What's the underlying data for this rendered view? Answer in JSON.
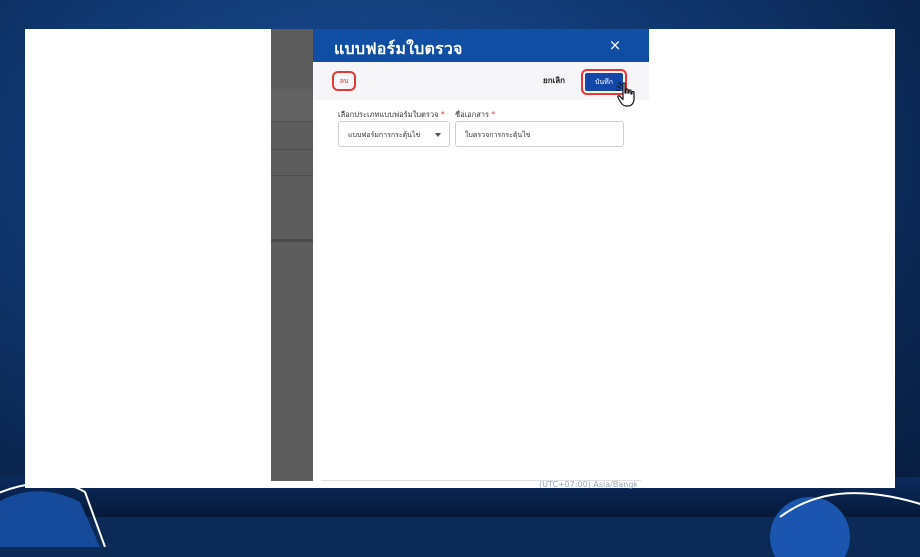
{
  "modal": {
    "title": "แบบฟอร์มใบตรวจ",
    "close_label": "×"
  },
  "toolbar": {
    "delete_label": "ลบ",
    "cancel_label": "ยกเลิก",
    "save_label": "บันทึก"
  },
  "form": {
    "type_label": "เลือกประเภทแบบฟอร์มใบตรวจ",
    "type_value": "แบบฟอร์มการกระตุ้นไข่",
    "doc_label": "ชื่อเอกสาร",
    "doc_value": "ใบตรวจการกระตุ้นไข่",
    "required_mark": "*"
  },
  "footer": {
    "timezone": "(UTC+07:00) Asia/Bangkok"
  },
  "colors": {
    "header": "#0f4ea3",
    "save_button": "#1448a8",
    "highlight": "#e53935"
  }
}
